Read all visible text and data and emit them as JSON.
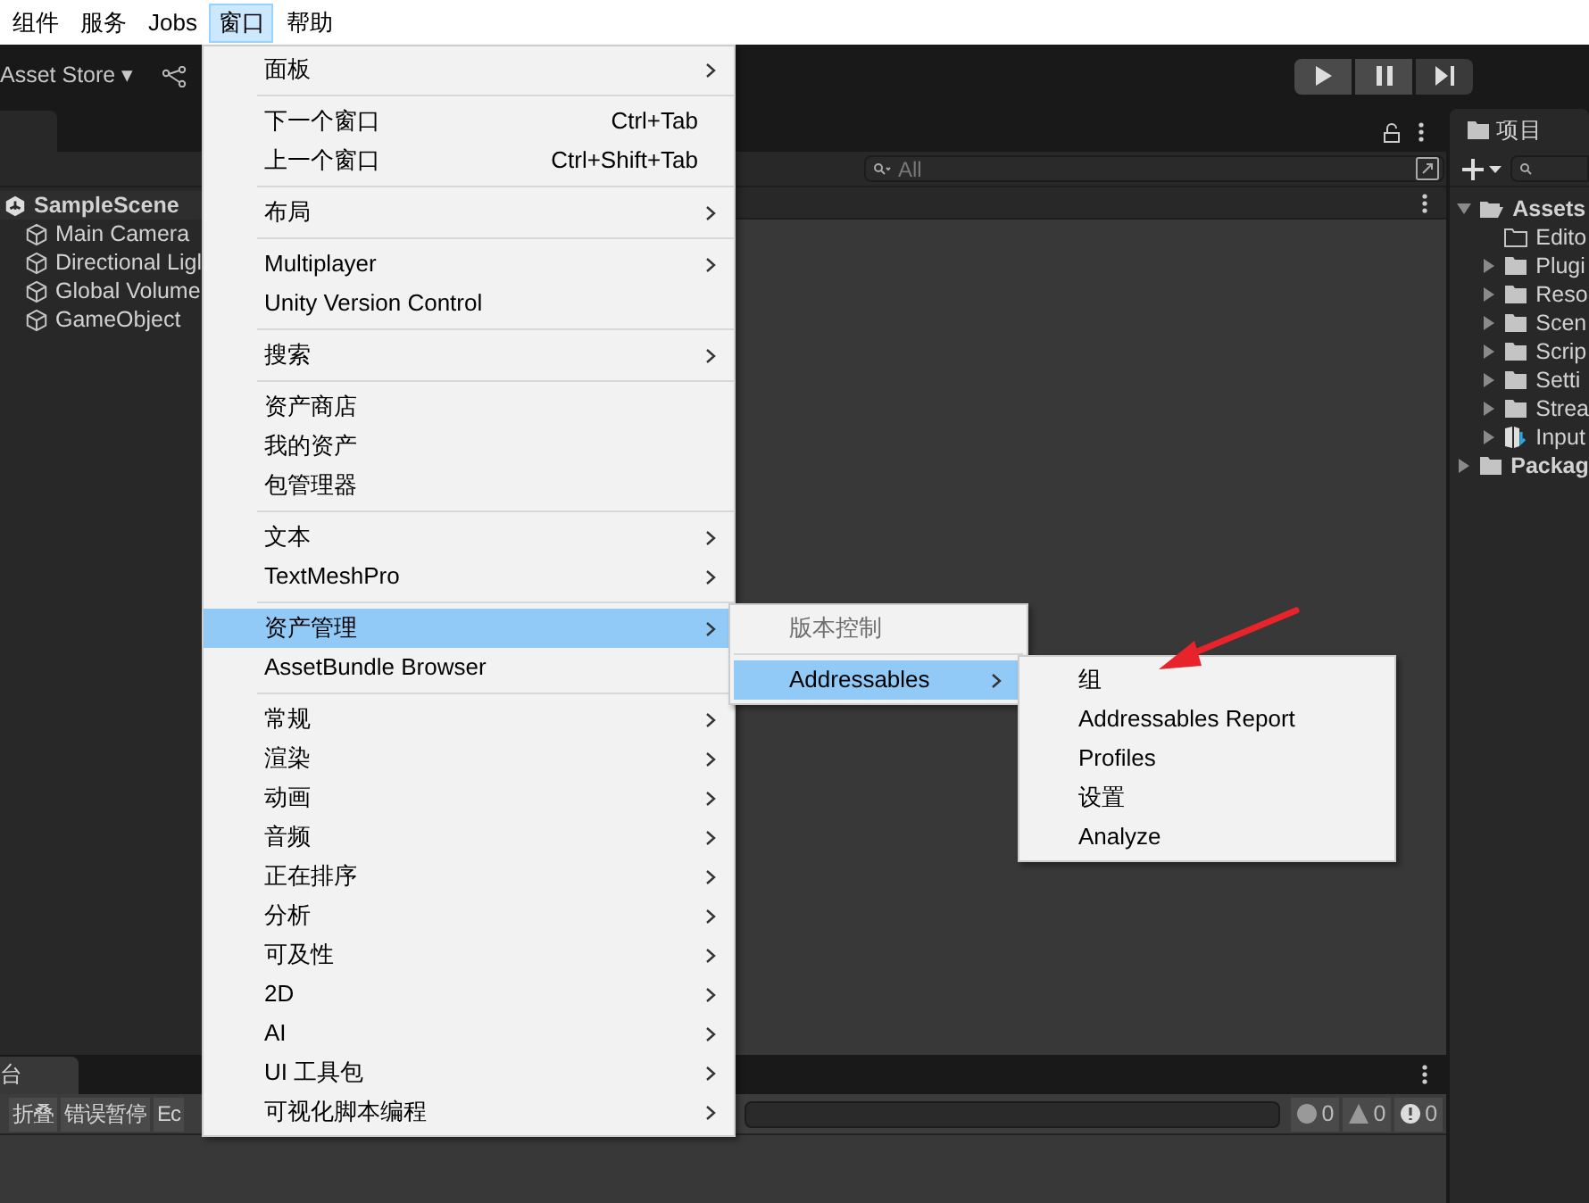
{
  "menu_bar": [
    {
      "label": "组件",
      "selected": false
    },
    {
      "label": "服务",
      "selected": false
    },
    {
      "label": "Jobs",
      "selected": false
    },
    {
      "label": "窗口",
      "selected": true
    },
    {
      "label": "帮助",
      "selected": false
    }
  ],
  "toolbar": {
    "account": "Asset Store ▾"
  },
  "hierarchy": {
    "items": [
      {
        "label": "SampleScene",
        "kind": "scene"
      },
      {
        "label": "Main Camera",
        "kind": "object"
      },
      {
        "label": "Directional Ligl",
        "kind": "object"
      },
      {
        "label": "Global Volume",
        "kind": "object"
      },
      {
        "label": "GameObject",
        "kind": "object"
      }
    ]
  },
  "scene": {
    "search_placeholder": "All"
  },
  "project": {
    "title": "项目",
    "tree": [
      {
        "label": "Assets",
        "kind": "open",
        "expanded": true,
        "children": [
          {
            "label": "Edito",
            "kind": "empty"
          },
          {
            "label": "Plugi",
            "kind": "folder",
            "expanded": false
          },
          {
            "label": "Reso",
            "kind": "folder",
            "expanded": false
          },
          {
            "label": "Scen",
            "kind": "folder",
            "expanded": false
          },
          {
            "label": "Scrip",
            "kind": "folder",
            "expanded": false
          },
          {
            "label": "Setti",
            "kind": "folder",
            "expanded": false
          },
          {
            "label": "Strea",
            "kind": "folder",
            "expanded": false
          },
          {
            "label": "Input",
            "kind": "asset",
            "expanded": false
          }
        ]
      },
      {
        "label": "Packag",
        "kind": "folder",
        "expanded": false
      }
    ]
  },
  "console": {
    "tab": "台",
    "buttons": [
      "折叠",
      "错误暂停",
      "Ec"
    ],
    "counts": [
      {
        "kind": "info",
        "count": "0"
      },
      {
        "kind": "warning",
        "count": "0"
      },
      {
        "kind": "error",
        "count": "0"
      }
    ]
  },
  "window_menu": {
    "groups": [
      [
        {
          "label": "面板",
          "submenu": true,
          "selected": false
        }
      ],
      [
        {
          "label": "下一个窗口",
          "shortcut": "Ctrl+Tab",
          "submenu": false,
          "selected": false
        },
        {
          "label": "上一个窗口",
          "shortcut": "Ctrl+Shift+Tab",
          "submenu": false,
          "selected": false
        }
      ],
      [
        {
          "label": "布局",
          "submenu": true,
          "selected": false
        }
      ],
      [
        {
          "label": "Multiplayer",
          "submenu": true,
          "selected": false
        },
        {
          "label": "Unity Version Control",
          "submenu": false,
          "selected": false
        }
      ],
      [
        {
          "label": "搜索",
          "submenu": true,
          "selected": false
        }
      ],
      [
        {
          "label": "资产商店",
          "submenu": false,
          "selected": false
        },
        {
          "label": "我的资产",
          "submenu": false,
          "selected": false
        },
        {
          "label": "包管理器",
          "submenu": false,
          "selected": false
        }
      ],
      [
        {
          "label": "文本",
          "submenu": true,
          "selected": false
        },
        {
          "label": "TextMeshPro",
          "submenu": true,
          "selected": false
        }
      ],
      [
        {
          "label": "资产管理",
          "submenu": true,
          "selected": true
        },
        {
          "label": "AssetBundle Browser",
          "submenu": false,
          "selected": false
        }
      ],
      [
        {
          "label": "常规",
          "submenu": true,
          "selected": false
        },
        {
          "label": "渲染",
          "submenu": true,
          "selected": false
        },
        {
          "label": "动画",
          "submenu": true,
          "selected": false
        },
        {
          "label": "音频",
          "submenu": true,
          "selected": false
        },
        {
          "label": "正在排序",
          "submenu": true,
          "selected": false
        },
        {
          "label": "分析",
          "submenu": true,
          "selected": false
        },
        {
          "label": "可及性",
          "submenu": true,
          "selected": false
        },
        {
          "label": "2D",
          "submenu": true,
          "selected": false
        },
        {
          "label": "AI",
          "submenu": true,
          "selected": false
        },
        {
          "label": "UI 工具包",
          "submenu": true,
          "selected": false
        },
        {
          "label": "可视化脚本编程",
          "submenu": true,
          "selected": false
        }
      ]
    ]
  },
  "asset_menu": {
    "items": [
      {
        "label": "版本控制",
        "submenu": false,
        "selected": false,
        "disabled": true
      },
      {
        "label": "Addressables",
        "submenu": true,
        "selected": true,
        "disabled": false
      }
    ]
  },
  "addressables_menu": {
    "items": [
      {
        "label": "组",
        "selected": false
      },
      {
        "label": "Addressables Report",
        "selected": false
      },
      {
        "label": "Profiles",
        "selected": false
      },
      {
        "label": "设置",
        "selected": false
      },
      {
        "label": "Analyze",
        "selected": false
      }
    ]
  }
}
